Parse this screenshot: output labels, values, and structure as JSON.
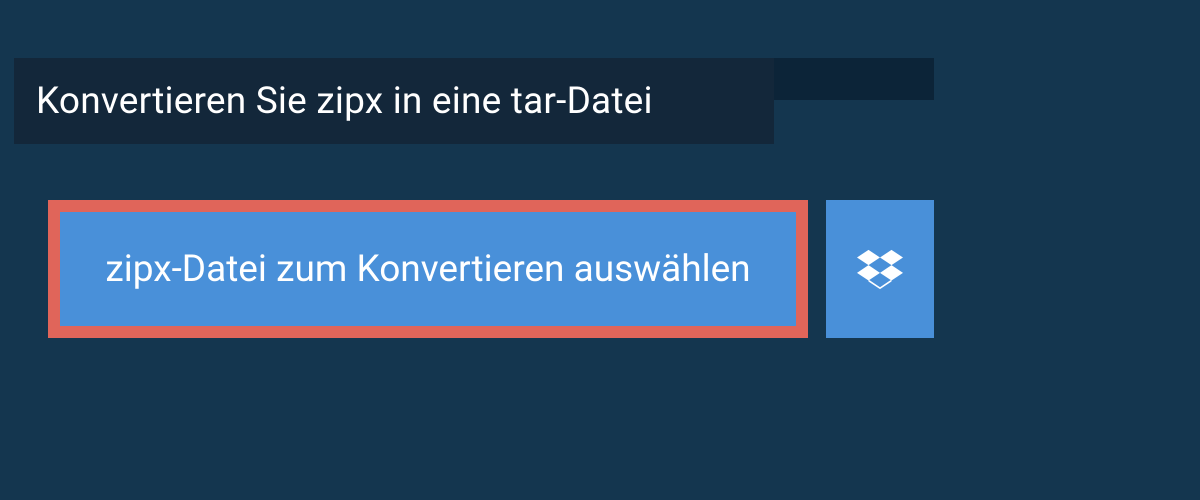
{
  "heading": "Konvertieren Sie zipx in eine tar-Datei",
  "buttons": {
    "select_file": "zipx-Datei zum Konvertieren auswählen"
  },
  "colors": {
    "page_bg": "#14364f",
    "panel_bg": "#0c2438",
    "heading_bg": "#13273a",
    "button_bg": "#4990d9",
    "highlight_border": "#e0655a",
    "text": "#ffffff"
  }
}
